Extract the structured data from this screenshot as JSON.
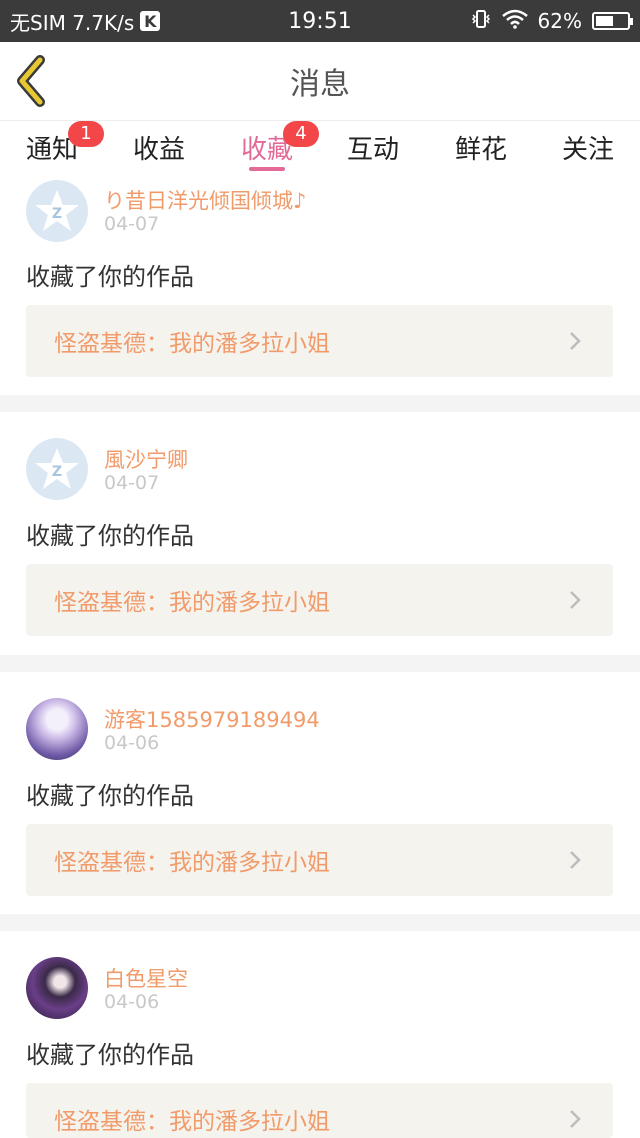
{
  "status_bar": {
    "carrier": "无SIM 7.7K/s",
    "k_icon_letter": "K",
    "time": "19:51",
    "battery_text": "62%",
    "battery_level": 0.62
  },
  "nav": {
    "title": "消息",
    "back_icon": "chevron-left-icon",
    "accent_color": "#e8c832"
  },
  "tabs": [
    {
      "label": "通知",
      "badge": "1",
      "active": false
    },
    {
      "label": "收益",
      "badge": null,
      "active": false
    },
    {
      "label": "收藏",
      "badge": "4",
      "active": true
    },
    {
      "label": "互动",
      "badge": null,
      "active": false
    },
    {
      "label": "鲜花",
      "badge": null,
      "active": false
    },
    {
      "label": "关注",
      "badge": null,
      "active": false
    }
  ],
  "colors": {
    "active_tab": "#e36a97",
    "badge": "#f24648",
    "username": "#f19b6b",
    "date": "#c8c8c8"
  },
  "messages": [
    {
      "username": "り昔日洋光倾国倾城♪",
      "date": "04-07",
      "text": "收藏了你的作品",
      "work_title": "怪盗基德：我的潘多拉小姐",
      "avatar": "default-avatar-icon"
    },
    {
      "username": "風沙宁卿",
      "date": "04-07",
      "text": "收藏了你的作品",
      "work_title": "怪盗基德：我的潘多拉小姐",
      "avatar": "default-avatar-icon"
    },
    {
      "username": "游客1585979189494",
      "date": "04-06",
      "text": "收藏了你的作品",
      "work_title": "怪盗基德：我的潘多拉小姐",
      "avatar": "user-photo-1"
    },
    {
      "username": "白色星空",
      "date": "04-06",
      "text": "收藏了你的作品",
      "work_title": "怪盗基德：我的潘多拉小姐",
      "avatar": "user-photo-2"
    }
  ]
}
